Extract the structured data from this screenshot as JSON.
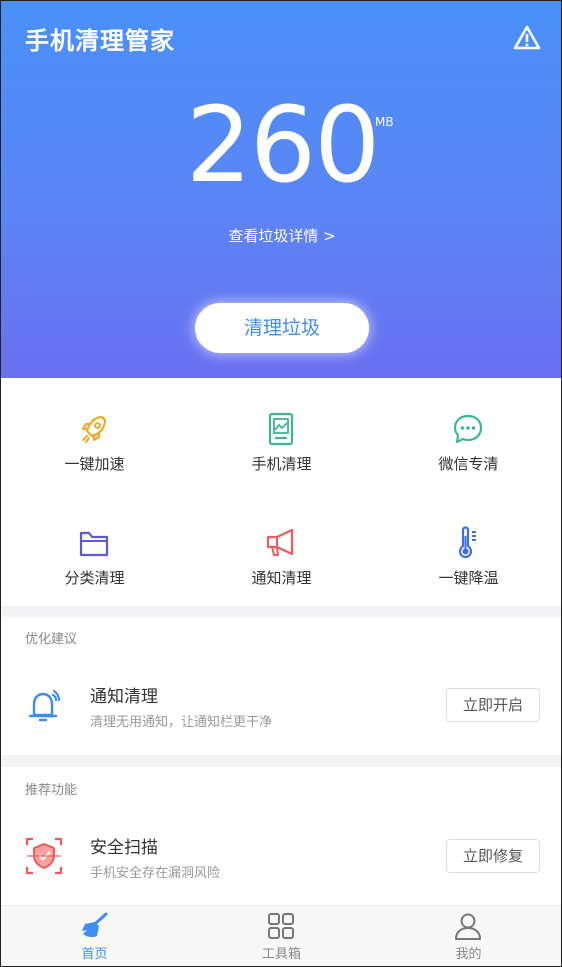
{
  "header": {
    "app_title": "手机清理管家",
    "warning_icon": "warning-triangle-icon",
    "junk_size": "260",
    "junk_unit": "MB",
    "detail_link": "查看垃圾详情 >",
    "clean_button": "清理垃圾"
  },
  "tools": [
    {
      "label": "一键加速",
      "icon": "rocket-icon",
      "color": "#f5a623"
    },
    {
      "label": "手机清理",
      "icon": "phone-clean-icon",
      "color": "#3fb58e"
    },
    {
      "label": "微信专清",
      "icon": "wechat-chat-icon",
      "color": "#3fb58e"
    },
    {
      "label": "分类清理",
      "icon": "folder-icon",
      "color": "#5c5ad8"
    },
    {
      "label": "通知清理",
      "icon": "megaphone-icon",
      "color": "#f05a5a"
    },
    {
      "label": "一键降温",
      "icon": "thermometer-icon",
      "color": "#3d6fe0"
    }
  ],
  "optimization": {
    "section_title": "优化建议",
    "title": "通知清理",
    "description": "清理无用通知，让通知栏更干净",
    "button": "立即开启",
    "icon": "bell-icon"
  },
  "recommended": {
    "section_title": "推荐功能",
    "title": "安全扫描",
    "description": "手机安全存在漏洞风险",
    "button": "立即修复",
    "icon": "shield-scan-icon"
  },
  "tabbar": {
    "tabs": [
      {
        "label": "首页",
        "icon": "broom-icon",
        "active": true
      },
      {
        "label": "工具箱",
        "icon": "grid-icon",
        "active": false
      },
      {
        "label": "我的",
        "icon": "user-icon",
        "active": false
      }
    ]
  }
}
